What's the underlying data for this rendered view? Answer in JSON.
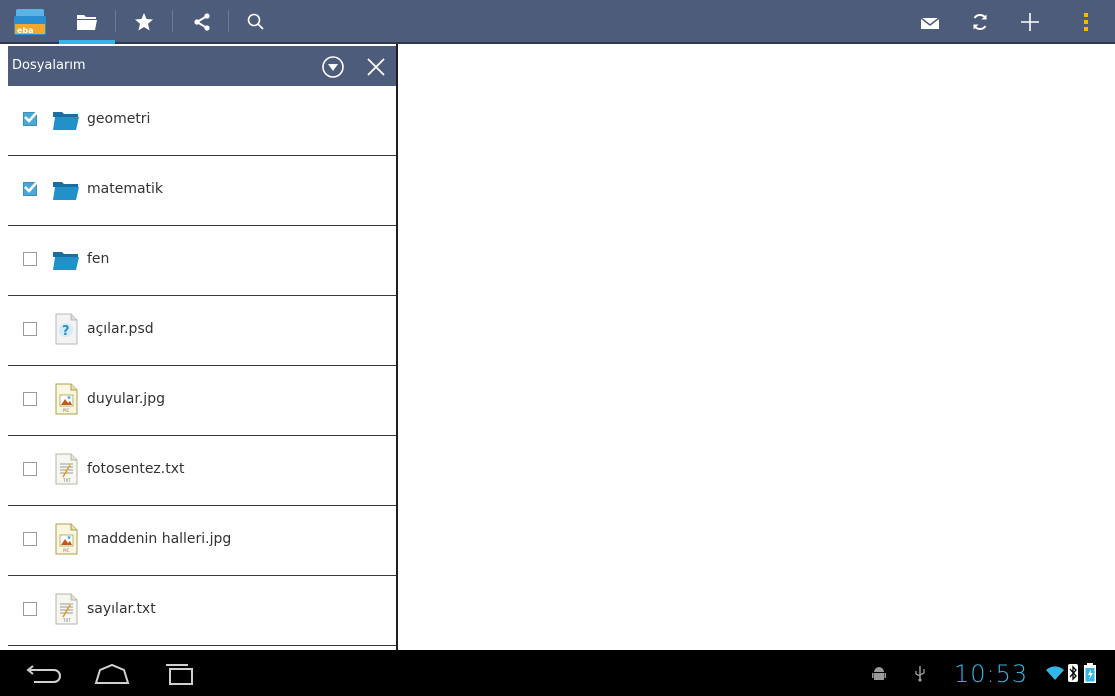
{
  "toolbar": {
    "app_logo": "eba-logo-icon",
    "tabs": [
      "folder-icon",
      "star-icon",
      "share-icon",
      "search-icon"
    ],
    "actions": [
      "mail-icon",
      "refresh-icon",
      "add-icon",
      "overflow-menu-icon"
    ],
    "accent_color": "#33b5e5"
  },
  "panel": {
    "title": "Dosyalarım"
  },
  "files": [
    {
      "name": "geometri",
      "type": "folder",
      "checked": true
    },
    {
      "name": "matematik",
      "type": "folder",
      "checked": true
    },
    {
      "name": "fen",
      "type": "folder",
      "checked": false
    },
    {
      "name": "açılar.psd",
      "type": "unknown",
      "checked": false
    },
    {
      "name": "duyular.jpg",
      "type": "image",
      "checked": false
    },
    {
      "name": "fotosentez.txt",
      "type": "text",
      "checked": false
    },
    {
      "name": "maddenin halleri.jpg",
      "type": "image",
      "checked": false
    },
    {
      "name": "sayılar.txt",
      "type": "text",
      "checked": false
    }
  ],
  "status": {
    "time": "10:53"
  }
}
